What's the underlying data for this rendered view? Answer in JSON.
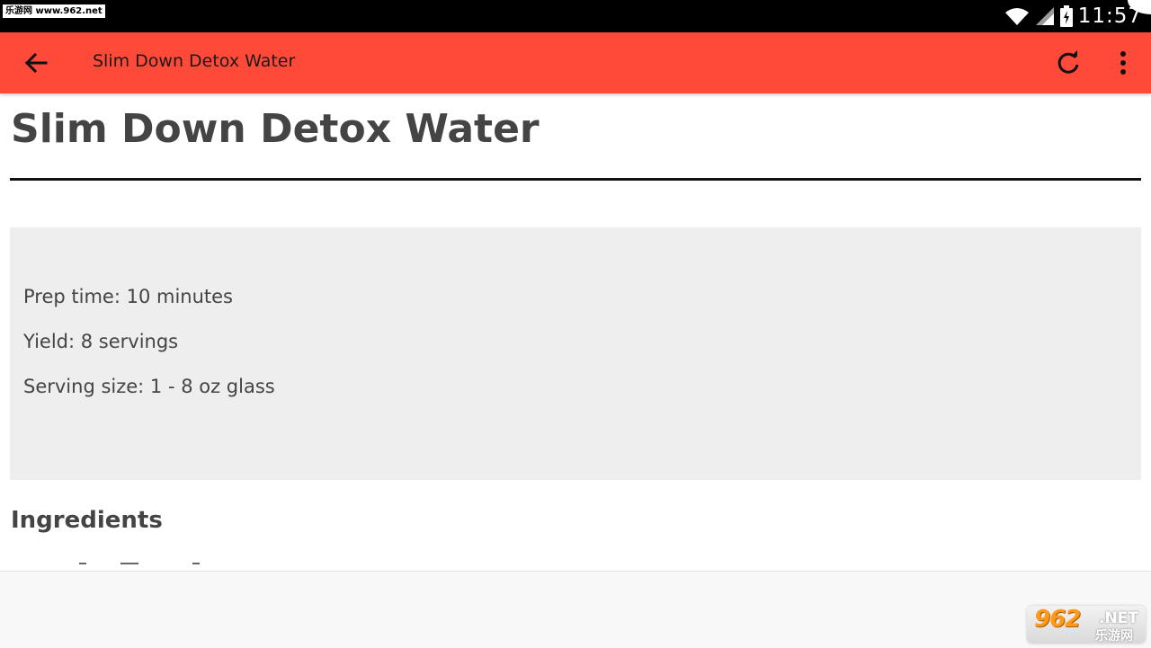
{
  "status_bar": {
    "watermark": "乐游网 www.962.net",
    "time": "11:57",
    "icons": [
      "wifi-icon",
      "signal-icon",
      "battery-icon"
    ]
  },
  "app_bar": {
    "title": "Slim Down Detox Water",
    "color": "#ff4a3a",
    "icons": [
      "back-arrow-icon",
      "refresh-icon",
      "more-vert-icon"
    ]
  },
  "recipe": {
    "title": "Slim Down Detox Water",
    "info": [
      "Prep time: 10 minutes",
      "Yield: 8 servings",
      "Serving size: 1 - 8 oz glass"
    ],
    "ingredients_heading": "Ingredients"
  },
  "watermark_br": {
    "big": "962",
    "net": ".NET",
    "cn": "乐游网"
  }
}
